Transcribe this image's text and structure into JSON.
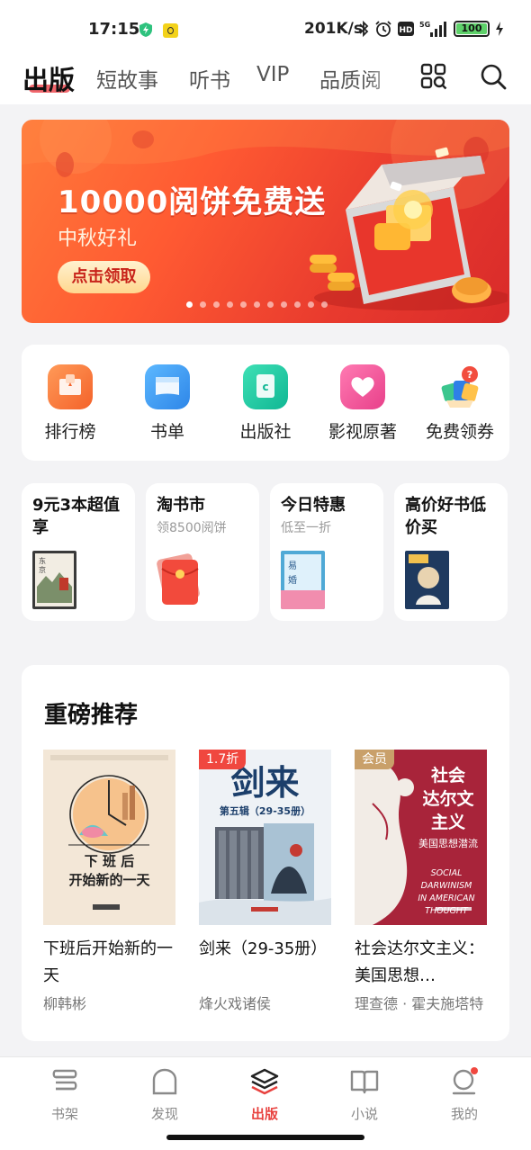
{
  "status": {
    "time": "17:15",
    "speed": "201K/s",
    "network": "5G",
    "battery": "100"
  },
  "nav": {
    "tabs": [
      {
        "label": "出版",
        "active": true
      },
      {
        "label": "短故事"
      },
      {
        "label": "听书"
      },
      {
        "label": "VIP"
      },
      {
        "label": "品质阅"
      }
    ],
    "icons": [
      "grid-search-icon",
      "search-icon"
    ]
  },
  "banner": {
    "title": "10000阅饼免费送",
    "subtitle": "中秋好礼",
    "button": "点击领取",
    "slide_count": 11,
    "active_slide": 1
  },
  "quick": [
    {
      "label": "排行榜",
      "icon": "ranking-icon",
      "color": "#fb7a3a"
    },
    {
      "label": "书单",
      "icon": "booklist-icon",
      "color": "#3d9bf0"
    },
    {
      "label": "出版社",
      "icon": "publisher-icon",
      "color": "#1ec9a4"
    },
    {
      "label": "影视原著",
      "icon": "heart-icon",
      "color": "#f25a9a"
    },
    {
      "label": "免费领券",
      "icon": "coupon-gift-icon",
      "color": "#ff6b4a"
    }
  ],
  "promos": [
    {
      "title": "9元3本超值享",
      "subtitle": ""
    },
    {
      "title": "淘书市",
      "subtitle": "领8500阅饼"
    },
    {
      "title": "今日特惠",
      "subtitle": "低至一折"
    },
    {
      "title": "高价好书低价买",
      "subtitle": ""
    }
  ],
  "recommend": {
    "title": "重磅推荐",
    "books": [
      {
        "title": "下班后开始新的一天",
        "author": "柳韩彬",
        "badge": "",
        "cover": {
          "l1": "下 班 后",
          "l2": "开始新的一天"
        }
      },
      {
        "title": "剑来（29-35册）",
        "author": "烽火戏诸侯",
        "badge": "1.7折",
        "cover": {
          "l1": "剑来",
          "l2": "第五辑（29-35册）"
        }
      },
      {
        "title": "社会达尔文主义：美国思想…",
        "author": "理查德 · 霍夫施塔特",
        "badge": "会员",
        "cover": {
          "l1": "社会",
          "l2": "达尔文",
          "l3": "主义",
          "l4": "美国思想潜流",
          "en1": "SOCIAL",
          "en2": "DARWINISM",
          "en3": "IN AMERICAN",
          "en4": "THOUGHT"
        }
      }
    ]
  },
  "bottom_nav": [
    {
      "label": "书架",
      "icon": "bookshelf-icon"
    },
    {
      "label": "发现",
      "icon": "discover-icon"
    },
    {
      "label": "出版",
      "icon": "publish-icon",
      "active": true
    },
    {
      "label": "小说",
      "icon": "novel-icon"
    },
    {
      "label": "我的",
      "icon": "profile-icon"
    }
  ],
  "colors": {
    "accent": "#e8423f",
    "banner": "#ff5a32",
    "background": "#f3f3f5"
  }
}
